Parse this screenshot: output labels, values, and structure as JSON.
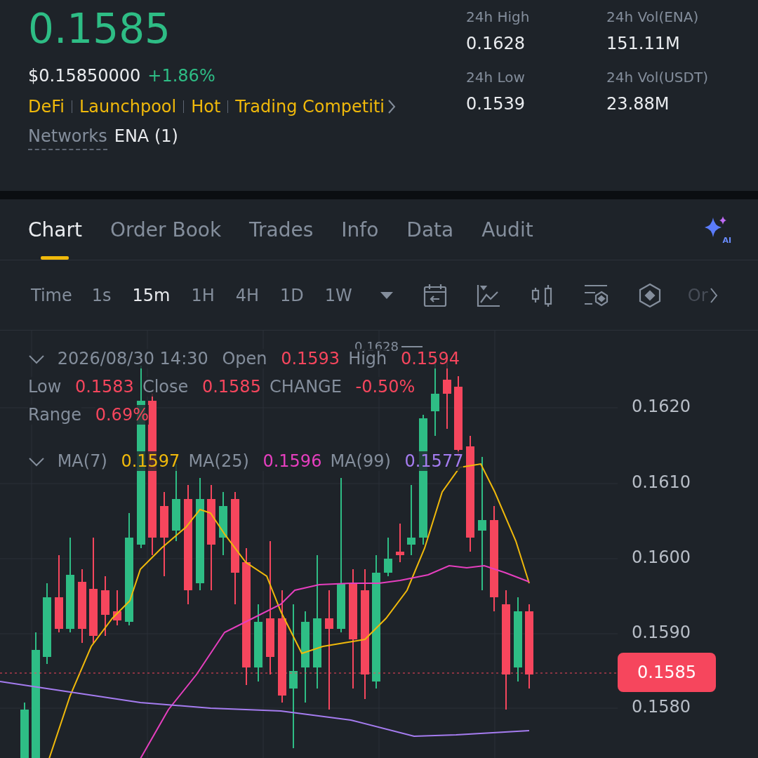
{
  "price": {
    "last": "0.1585",
    "usd": "$0.15850000",
    "change": "+1.86%",
    "up": true
  },
  "tags": [
    "DeFi",
    "Launchpool",
    "Hot",
    "Trading Competiti"
  ],
  "networks": {
    "label": "Networks",
    "value": "ENA (1)"
  },
  "stats": [
    {
      "label": "24h High",
      "value": "0.1628"
    },
    {
      "label": "24h Vol(ENA)",
      "value": "151.11M"
    },
    {
      "label": "24h Low",
      "value": "0.1539"
    },
    {
      "label": "24h Vol(USDT)",
      "value": "23.88M"
    }
  ],
  "ai_badge": "AI",
  "tabs": [
    {
      "label": "Chart",
      "selected": true
    },
    {
      "label": "Order Book",
      "selected": false
    },
    {
      "label": "Trades",
      "selected": false
    },
    {
      "label": "Info",
      "selected": false
    },
    {
      "label": "Data",
      "selected": false
    },
    {
      "label": "Audit",
      "selected": false
    }
  ],
  "toolbar": {
    "label": "Time",
    "intervals": [
      {
        "label": "1s",
        "selected": false
      },
      {
        "label": "15m",
        "selected": true
      },
      {
        "label": "1H",
        "selected": false
      },
      {
        "label": "4H",
        "selected": false
      },
      {
        "label": "1D",
        "selected": false
      },
      {
        "label": "1W",
        "selected": false
      }
    ],
    "more": "Or"
  },
  "chart": {
    "candle_time": "2026/08/30 14:30",
    "candle_up": false,
    "ohlc": [
      {
        "label": "Open",
        "value": "0.1593"
      },
      {
        "label": "High",
        "value": "0.1594"
      },
      {
        "label": "Low",
        "value": "0.1583"
      },
      {
        "label": "Close",
        "value": "0.1585"
      },
      {
        "label": "CHANGE",
        "value": "-0.50%"
      },
      {
        "label": "Range",
        "value": "0.69%"
      }
    ],
    "moving_averages": [
      {
        "label": "MA(7)",
        "value": "0.1597",
        "color": "#f0b90b"
      },
      {
        "label": "MA(25)",
        "value": "0.1596",
        "color": "#e63fbf"
      },
      {
        "label": "MA(99)",
        "value": "0.1577",
        "color": "#a57cf0"
      }
    ],
    "high_marker": "0.1628",
    "y_axis_labels": [
      "0.1620",
      "0.1610",
      "0.1600",
      "0.1590",
      "0.1580"
    ],
    "current_price": "0.1585"
  }
}
